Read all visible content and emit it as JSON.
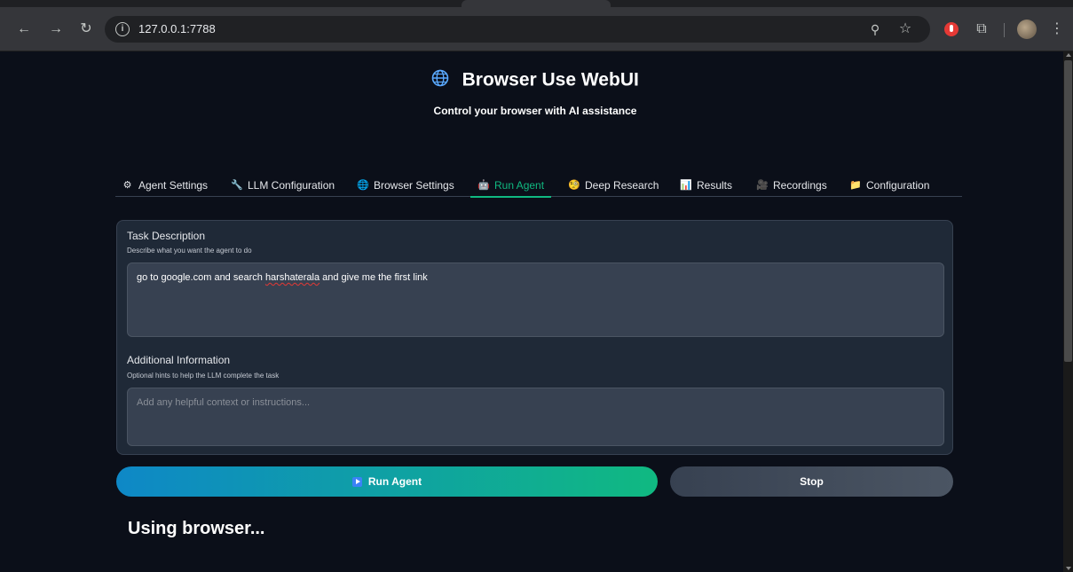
{
  "browser": {
    "url": "127.0.0.1:7788",
    "icons": [
      "back-icon",
      "forward-icon",
      "reload-icon",
      "info-icon",
      "zoom-icon",
      "star-icon",
      "extension-icon",
      "puzzle-icon",
      "profile-avatar",
      "menu-icon"
    ]
  },
  "header": {
    "title": "Browser Use WebUI",
    "subtitle": "Control your browser with AI assistance"
  },
  "tabs": [
    {
      "label": "Agent Settings",
      "icon": "gear-icon"
    },
    {
      "label": "LLM Configuration",
      "icon": "wrench-icon"
    },
    {
      "label": "Browser Settings",
      "icon": "globe-icon"
    },
    {
      "label": "Run Agent",
      "icon": "robot-icon",
      "active": true
    },
    {
      "label": "Deep Research",
      "icon": "brain-icon"
    },
    {
      "label": "Results",
      "icon": "chart-icon"
    },
    {
      "label": "Recordings",
      "icon": "film-icon"
    },
    {
      "label": "Configuration",
      "icon": "folder-icon"
    }
  ],
  "task": {
    "label": "Task Description",
    "hint": "Describe what you want the agent to do",
    "value_before": "go to google.com and search ",
    "value_misspelled": "harshaterala",
    "value_after": " and give me the first link"
  },
  "additional": {
    "label": "Additional Information",
    "hint": "Optional hints to help the LLM complete the task",
    "placeholder": "Add any helpful context or instructions..."
  },
  "buttons": {
    "run": "Run Agent",
    "stop": "Stop"
  },
  "status": "Using browser...",
  "colors": {
    "background": "#0b0f19",
    "accent": "#10b981",
    "panel": "#1f2937",
    "run_gradient_start": "#0e88c7",
    "run_gradient_end": "#10b981"
  }
}
